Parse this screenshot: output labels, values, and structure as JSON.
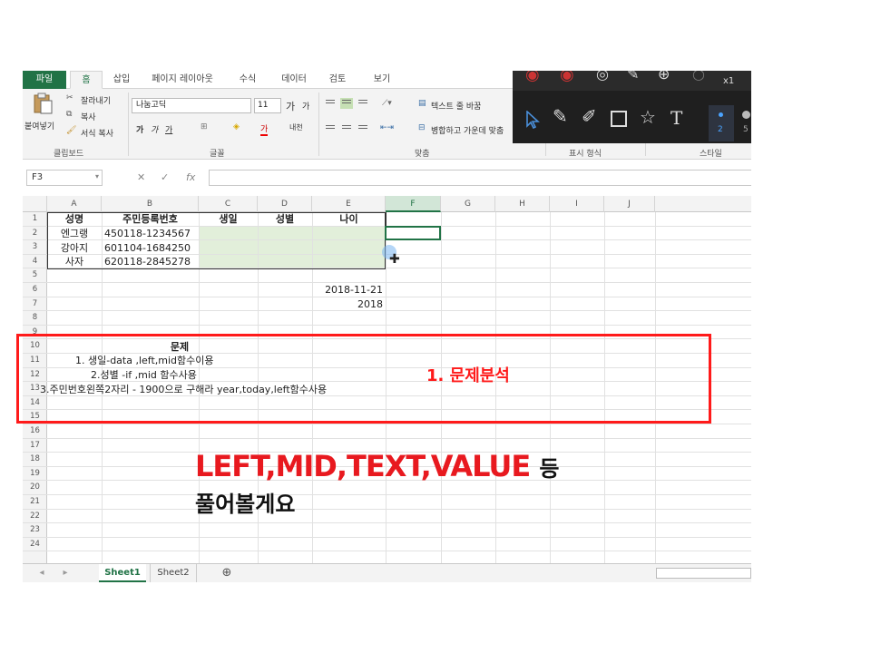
{
  "ribbon": {
    "tabs": [
      "파일",
      "홈",
      "삽입",
      "페이지 레이아웃",
      "수식",
      "데이터",
      "검토",
      "보기"
    ],
    "clipboard": {
      "paste": "붙여넣기",
      "cut": "잘라내기",
      "copy": "복사",
      "format_painter": "서식 복사",
      "label": "클립보드"
    },
    "font": {
      "name": "나눔고딕",
      "size": "11",
      "label": "글꼴",
      "grow": "가",
      "shrink": "가",
      "bold": "가",
      "italic": "가",
      "underline": "가",
      "color": "가",
      "phonetic": "내천"
    },
    "alignment": {
      "wrap": "텍스트 줄 바꿈",
      "merge": "병합하고 가운데 맞춤",
      "label": "맞춤"
    },
    "number": {
      "label": "표시 형식"
    },
    "styles": {
      "label": "스타일"
    }
  },
  "pen_toolbar": {
    "zoom": "x1",
    "thickness": "2",
    "thickness2": "5"
  },
  "formula_bar": {
    "name_box": "F3",
    "cancel": "✕",
    "enter": "✓",
    "fx": "fx"
  },
  "columns": [
    "A",
    "B",
    "C",
    "D",
    "E",
    "F",
    "G",
    "H",
    "I",
    "J"
  ],
  "rows": [
    "1",
    "2",
    "3",
    "4",
    "5",
    "6",
    "7",
    "8",
    "9",
    "10",
    "11",
    "12",
    "13",
    "14",
    "15",
    "16",
    "17",
    "18",
    "19",
    "20",
    "21",
    "22",
    "23",
    "24"
  ],
  "table": {
    "headers": [
      "성명",
      "주민등록번호",
      "생일",
      "성별",
      "나이"
    ],
    "rows": [
      [
        "엔그랭",
        "450118-1234567"
      ],
      [
        "강아지",
        "601104-1684250"
      ],
      [
        "사자",
        "620118-2845278"
      ]
    ]
  },
  "cells": {
    "e6": "2018-11-21",
    "e7": "2018",
    "problem_title": "문제",
    "q1": "1. 생일-data ,left,mid함수이용",
    "q2": "2.성별 -if ,mid 함수사용",
    "q3": "3.주민번호왼쪽2자리 - 1900으로 구해라 year,today,left함수사용"
  },
  "sheets": [
    "Sheet1",
    "Sheet2"
  ],
  "overlay": {
    "annotation": "1. 문제분석",
    "caption_red": "LEFT,MID,TEXT,VALUE",
    "caption_dark": "등",
    "caption_line2": "풀어볼게요"
  },
  "colors": {
    "excel_green": "#217346",
    "annotation_red": "#ff1a1a",
    "cell_fill": "#e2efda"
  }
}
